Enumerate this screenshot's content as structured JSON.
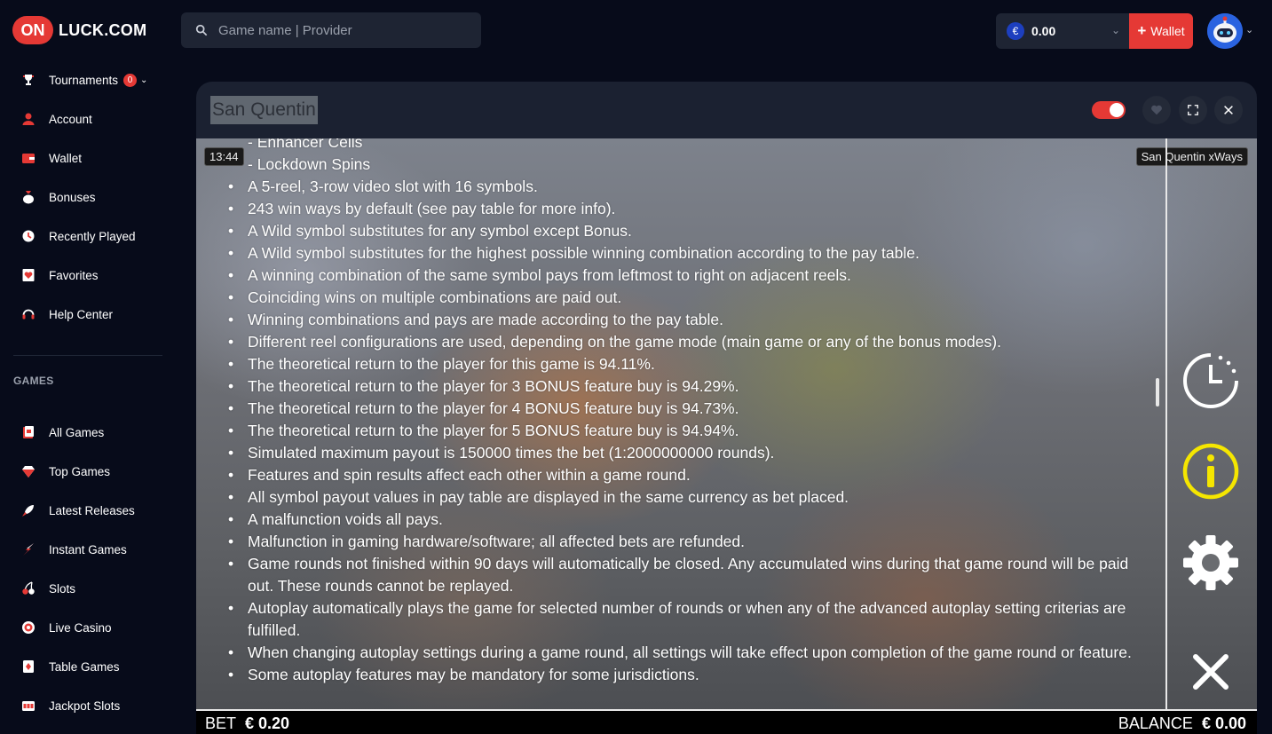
{
  "header": {
    "logo_badge": "ON",
    "logo_text": "LUCK.COM",
    "search_placeholder": "Game name | Provider",
    "currency_symbol": "€",
    "balance": "0.00",
    "wallet_label": "Wallet"
  },
  "sidebar": {
    "items": [
      {
        "label": "Tournaments",
        "icon": "trophy-icon",
        "badge": "0"
      },
      {
        "label": "Account",
        "icon": "user-icon"
      },
      {
        "label": "Wallet",
        "icon": "wallet-icon"
      },
      {
        "label": "Bonuses",
        "icon": "money-bag-icon"
      },
      {
        "label": "Recently Played",
        "icon": "clock-icon"
      },
      {
        "label": "Favorites",
        "icon": "heart-card-icon"
      },
      {
        "label": "Help Center",
        "icon": "headset-icon"
      }
    ],
    "games_section_label": "GAMES",
    "game_items": [
      {
        "label": "All Games",
        "icon": "cards-icon"
      },
      {
        "label": "Top Games",
        "icon": "diamond-icon"
      },
      {
        "label": "Latest Releases",
        "icon": "rocket-icon"
      },
      {
        "label": "Instant Games",
        "icon": "lightning-icon"
      },
      {
        "label": "Slots",
        "icon": "cherry-icon"
      },
      {
        "label": "Live Casino",
        "icon": "roulette-icon"
      },
      {
        "label": "Table Games",
        "icon": "playing-card-icon"
      },
      {
        "label": "Jackpot Slots",
        "icon": "slot-machine-icon"
      }
    ]
  },
  "game": {
    "title": "San Quentin",
    "time": "13:44",
    "name_tag": "San Quentin xWays",
    "sub_items": [
      "- Enhancer Cells",
      "- Lockdown Spins"
    ],
    "rules": [
      "A 5-reel, 3-row video slot with 16 symbols.",
      "243 win ways by default (see pay table for more info).",
      "A Wild symbol substitutes for any symbol except Bonus.",
      "A Wild symbol substitutes for the highest possible winning combination according to the pay table.",
      "A winning combination of the same symbol pays from leftmost to right on adjacent reels.",
      "Coinciding wins on multiple combinations are paid out.",
      "Winning combinations and pays are made according to the pay table.",
      "Different reel configurations are used, depending on the game mode (main game or any of the bonus modes).",
      "The theoretical return to the player for this game is 94.11%.",
      "The theoretical return to the player for 3 BONUS feature buy is 94.29%.",
      "The theoretical return to the player for 4 BONUS feature buy is 94.73%.",
      "The theoretical return to the player for 5 BONUS feature buy is 94.94%.",
      "Simulated maximum payout is 150000 times the bet (1:2000000000 rounds).",
      "Features and spin results affect each other within a game round.",
      "All symbol payout values in pay table are displayed in the same currency as bet placed.",
      "A malfunction voids all pays.",
      "Malfunction in gaming hardware/software; all affected bets are refunded.",
      "Game rounds not finished within 90 days will automatically be closed. Any accumulated wins during that game round will be paid out. These rounds cannot be replayed.",
      "Autoplay automatically plays the game for selected number of rounds or when any of the advanced autoplay setting criterias are fulfilled.",
      "When changing autoplay settings during a game round, all settings will take effect upon completion of the game round or feature.",
      "Some autoplay features may be mandatory for some jurisdictions."
    ],
    "bet_label": "BET",
    "bet_value": "€ 0.20",
    "balance_label": "BALANCE",
    "balance_value": "€ 0.00",
    "accent_color": "#e53935",
    "info_icon_color": "#f5e600"
  }
}
